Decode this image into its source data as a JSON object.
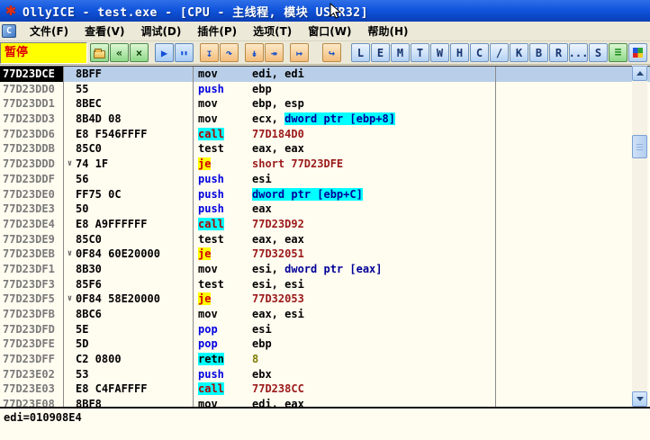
{
  "window": {
    "title": "OllyICE - test.exe - [CPU -  主线程, 模块  USER32]",
    "app_icon": "✱"
  },
  "menu": {
    "mdi_icon_label": "C",
    "items": [
      {
        "label": "文件(F)"
      },
      {
        "label": "查看(V)"
      },
      {
        "label": "调试(D)"
      },
      {
        "label": "插件(P)"
      },
      {
        "label": "选项(T)"
      },
      {
        "label": "窗口(W)"
      },
      {
        "label": "帮助(H)"
      }
    ]
  },
  "toolbar": {
    "status_text": "暂停",
    "status_bg": "#FFFF00",
    "status_color": "#E00000",
    "buttons": [
      {
        "name": "open-file-button",
        "glyph": "",
        "style": "green",
        "gap": false,
        "folder": true
      },
      {
        "name": "restart-button",
        "glyph": "«",
        "style": "green",
        "gap": false
      },
      {
        "name": "close-program-button",
        "glyph": "×",
        "style": "green",
        "gap": false
      },
      {
        "name": "run-button",
        "glyph": "▶",
        "style": "blue",
        "gap": true
      },
      {
        "name": "pause-button",
        "glyph": "▮▮",
        "style": "blue",
        "gap": false,
        "small": true
      },
      {
        "name": "step-into-button",
        "glyph": "↧",
        "style": "orange",
        "gap": true
      },
      {
        "name": "step-over-button",
        "glyph": "↷",
        "style": "orange",
        "gap": false
      },
      {
        "name": "animate-into-button",
        "glyph": "↡",
        "style": "orange",
        "gap": true
      },
      {
        "name": "animate-over-button",
        "glyph": "↠",
        "style": "orange",
        "gap": false
      },
      {
        "name": "execute-till-return-button",
        "glyph": "↦",
        "style": "orange",
        "gap": true
      },
      {
        "name": "go-to-address-button",
        "glyph": "↪",
        "style": "orange",
        "gap": true,
        "gapwide": true
      }
    ],
    "letter_buttons": [
      {
        "name": "open-log-window-button",
        "label": "L"
      },
      {
        "name": "open-executables-window-button",
        "label": "E"
      },
      {
        "name": "open-memory-window-button",
        "label": "M"
      },
      {
        "name": "open-threads-window-button",
        "label": "T"
      },
      {
        "name": "open-windows-window-button",
        "label": "W"
      },
      {
        "name": "open-handles-window-button",
        "label": "H"
      },
      {
        "name": "open-cpu-window-button",
        "label": "C"
      },
      {
        "name": "open-patches-window-button",
        "label": "/"
      },
      {
        "name": "open-callstack-window-button",
        "label": "K"
      },
      {
        "name": "open-breakpoints-window-button",
        "label": "B"
      },
      {
        "name": "open-references-window-button",
        "label": "R"
      },
      {
        "name": "open-runtrace-window-button",
        "label": "..."
      },
      {
        "name": "open-source-window-button",
        "label": "S"
      }
    ]
  },
  "disassembly": {
    "rows": [
      {
        "address": "77D23DCE",
        "bytes": "8BFF",
        "jump_mark": "",
        "mnemonic": "mov",
        "mn_style": "plain",
        "operands": [
          {
            "text": "edi, edi",
            "style": "plain"
          }
        ],
        "selected": true
      },
      {
        "address": "77D23DD0",
        "bytes": "55",
        "jump_mark": "",
        "mnemonic": "push",
        "mn_style": "stack",
        "operands": [
          {
            "text": "ebp",
            "style": "plain"
          }
        ]
      },
      {
        "address": "77D23DD1",
        "bytes": "8BEC",
        "jump_mark": "",
        "mnemonic": "mov",
        "mn_style": "plain",
        "operands": [
          {
            "text": "ebp, esp",
            "style": "plain"
          }
        ]
      },
      {
        "address": "77D23DD3",
        "bytes": "8B4D 08",
        "jump_mark": "",
        "mnemonic": "mov",
        "mn_style": "plain",
        "operands": [
          {
            "text": "ecx, ",
            "style": "plain"
          },
          {
            "text": "dword ptr [ebp+8]",
            "style": "memhi"
          }
        ]
      },
      {
        "address": "77D23DD6",
        "bytes": "E8 F546FFFF",
        "jump_mark": "",
        "mnemonic": "call",
        "mn_style": "call",
        "operands": [
          {
            "text": "77D184D0",
            "style": "target"
          }
        ]
      },
      {
        "address": "77D23DDB",
        "bytes": "85C0",
        "jump_mark": "",
        "mnemonic": "test",
        "mn_style": "plain",
        "operands": [
          {
            "text": "eax, eax",
            "style": "plain"
          }
        ]
      },
      {
        "address": "77D23DDD",
        "bytes": "74 1F",
        "jump_mark": "∨",
        "mnemonic": "je",
        "mn_style": "jump",
        "operands": [
          {
            "text": "short 77D23DFE",
            "style": "target"
          }
        ]
      },
      {
        "address": "77D23DDF",
        "bytes": "56",
        "jump_mark": "",
        "mnemonic": "push",
        "mn_style": "stack",
        "operands": [
          {
            "text": "esi",
            "style": "plain"
          }
        ]
      },
      {
        "address": "77D23DE0",
        "bytes": "FF75 0C",
        "jump_mark": "",
        "mnemonic": "push",
        "mn_style": "stack",
        "operands": [
          {
            "text": "dword ptr [ebp+C]",
            "style": "memhi"
          }
        ]
      },
      {
        "address": "77D23DE3",
        "bytes": "50",
        "jump_mark": "",
        "mnemonic": "push",
        "mn_style": "stack",
        "operands": [
          {
            "text": "eax",
            "style": "plain"
          }
        ]
      },
      {
        "address": "77D23DE4",
        "bytes": "E8 A9FFFFFF",
        "jump_mark": "",
        "mnemonic": "call",
        "mn_style": "call",
        "operands": [
          {
            "text": "77D23D92",
            "style": "target"
          }
        ]
      },
      {
        "address": "77D23DE9",
        "bytes": "85C0",
        "jump_mark": "",
        "mnemonic": "test",
        "mn_style": "plain",
        "operands": [
          {
            "text": "eax, eax",
            "style": "plain"
          }
        ]
      },
      {
        "address": "77D23DEB",
        "bytes": "0F84 60E20000",
        "jump_mark": "∨",
        "mnemonic": "je",
        "mn_style": "jump",
        "operands": [
          {
            "text": "77D32051",
            "style": "target"
          }
        ]
      },
      {
        "address": "77D23DF1",
        "bytes": "8B30",
        "jump_mark": "",
        "mnemonic": "mov",
        "mn_style": "plain",
        "operands": [
          {
            "text": "esi, ",
            "style": "plain"
          },
          {
            "text": "dword ptr [eax]",
            "style": "mem"
          }
        ]
      },
      {
        "address": "77D23DF3",
        "bytes": "85F6",
        "jump_mark": "",
        "mnemonic": "test",
        "mn_style": "plain",
        "operands": [
          {
            "text": "esi, esi",
            "style": "plain"
          }
        ]
      },
      {
        "address": "77D23DF5",
        "bytes": "0F84 58E20000",
        "jump_mark": "∨",
        "mnemonic": "je",
        "mn_style": "jump",
        "operands": [
          {
            "text": "77D32053",
            "style": "target"
          }
        ]
      },
      {
        "address": "77D23DFB",
        "bytes": "8BC6",
        "jump_mark": "",
        "mnemonic": "mov",
        "mn_style": "plain",
        "operands": [
          {
            "text": "eax, esi",
            "style": "plain"
          }
        ]
      },
      {
        "address": "77D23DFD",
        "bytes": "5E",
        "jump_mark": "",
        "mnemonic": "pop",
        "mn_style": "stack",
        "operands": [
          {
            "text": "esi",
            "style": "plain"
          }
        ]
      },
      {
        "address": "77D23DFE",
        "bytes": "5D",
        "jump_mark": "",
        "mnemonic": "pop",
        "mn_style": "stack",
        "operands": [
          {
            "text": "ebp",
            "style": "plain"
          }
        ]
      },
      {
        "address": "77D23DFF",
        "bytes": "C2 0800",
        "jump_mark": "",
        "mnemonic": "retn",
        "mn_style": "retn",
        "operands": [
          {
            "text": "8",
            "style": "imm"
          }
        ]
      },
      {
        "address": "77D23E02",
        "bytes": "53",
        "jump_mark": "",
        "mnemonic": "push",
        "mn_style": "stack",
        "operands": [
          {
            "text": "ebx",
            "style": "plain"
          }
        ]
      },
      {
        "address": "77D23E03",
        "bytes": "E8 C4FAFFFF",
        "jump_mark": "",
        "mnemonic": "call",
        "mn_style": "call",
        "operands": [
          {
            "text": "77D238CC",
            "style": "target"
          }
        ]
      },
      {
        "address": "77D23E08",
        "bytes": "8BF8",
        "jump_mark": "",
        "mnemonic": "mov",
        "mn_style": "plain",
        "operands": [
          {
            "text": "edi, eax",
            "style": "plain"
          }
        ]
      }
    ]
  },
  "info_pane": {
    "text": "edi=010908E4"
  },
  "colors": {
    "highlight_cyan": "#00FFFF",
    "highlight_yellow": "#FFFF00",
    "selected_row": "#B9CFE9",
    "listing_bg": "#FFFCF0",
    "pause_text": "#E00000",
    "jump_target_red": "#9B1A1A",
    "stack_op_blue": "#0000E0",
    "mem_operand_blue": "#000098",
    "immediate_olive": "#7C7C00",
    "titlebar_blue": "#1155DD"
  }
}
